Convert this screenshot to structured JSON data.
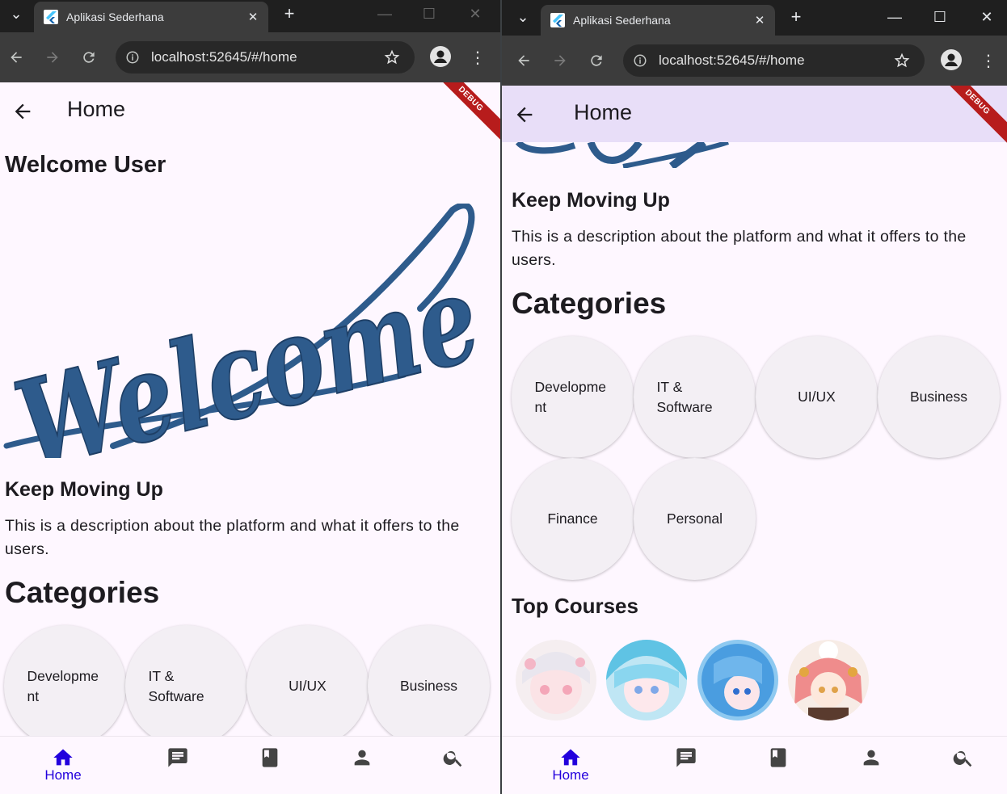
{
  "browser": {
    "tab_title": "Aplikasi Sederhana",
    "url": "localhost:52645/#/home"
  },
  "appbar": {
    "title": "Home"
  },
  "debug_banner": "DEBUG",
  "home": {
    "welcome_heading": "Welcome User",
    "welcome_image_text": "Welcome",
    "subtitle": "Keep Moving Up",
    "description_line1": "This is a description about the platform and what it offers to the",
    "description_line2": "users.",
    "categories_heading": "Categories",
    "categories": [
      {
        "line1": "Developme",
        "line2": "nt"
      },
      {
        "line1": "IT &",
        "line2": "Software"
      },
      {
        "line1": "UI/UX",
        "line2": ""
      },
      {
        "line1": "Business",
        "line2": ""
      },
      {
        "line1": "Finance",
        "line2": ""
      },
      {
        "line1": "Personal",
        "line2": ""
      }
    ],
    "top_courses_heading": "Top Courses"
  },
  "bottom_nav": {
    "active_label": "Home",
    "items": [
      "home-icon",
      "chat-icon",
      "book-icon",
      "person-icon",
      "search-icon"
    ],
    "active_color": "#2200dd"
  },
  "colors": {
    "page_bg": "#fef7ff",
    "appbar_scrolled": "#e8def8",
    "welcome_blue": "#2e5b8c",
    "debug_red": "#b71c1c"
  }
}
